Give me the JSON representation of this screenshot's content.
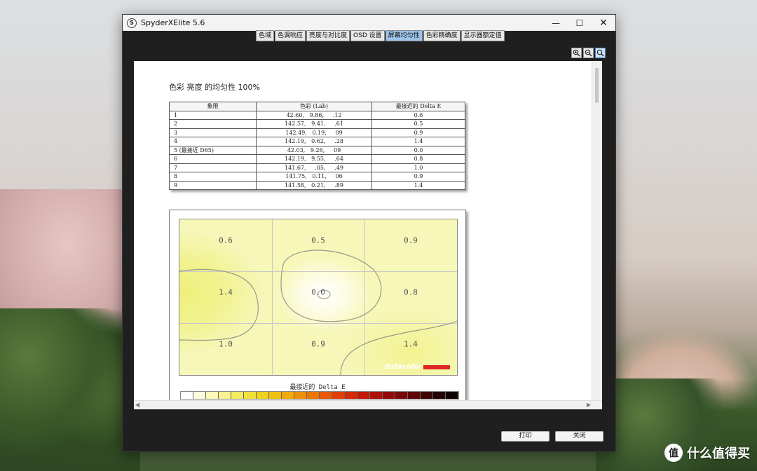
{
  "window": {
    "title": "SpyderXElite 5.6",
    "icon_letter": "S",
    "controls": {
      "minimize": "—",
      "maximize": "☐",
      "close": "✕"
    }
  },
  "tabs": [
    {
      "label": "色域",
      "active": false
    },
    {
      "label": "色调响应",
      "active": false
    },
    {
      "label": "亮度与对比度",
      "active": false
    },
    {
      "label": "OSD 设置",
      "active": false
    },
    {
      "label": "屏幕均匀性",
      "active": true
    },
    {
      "label": "色彩精确度",
      "active": false
    },
    {
      "label": "显示器额定值",
      "active": false
    }
  ],
  "zoom_tools": [
    "zoom-in-icon",
    "zoom-out-icon",
    "zoom-fit-icon"
  ],
  "report": {
    "title": "色彩 亮度 的均匀性 100%",
    "table": {
      "headers": [
        "象限",
        "色彩 (Lab)",
        "最接近的 Delta E"
      ],
      "rows": [
        [
          "1",
          "42.60,   9.86,     .12",
          "0.6"
        ],
        [
          "2",
          "142.57,   9.41,     .61",
          "0.5"
        ],
        [
          "3",
          "142.49,   0.19,     09",
          "0.9"
        ],
        [
          "4",
          "142.19,   0.62,     .28",
          "1.4"
        ],
        [
          "5 (最接近 D65)",
          "42.03,   9.26,     09",
          "0.0"
        ],
        [
          "6",
          "142.19,   9.55,     .64",
          "0.8"
        ],
        [
          "7",
          "141.67,     .05,     .49",
          "1.0"
        ],
        [
          "8",
          "141.75,   0.11,     06",
          "0.9"
        ],
        [
          "9",
          "141.58,   0.21,     .89",
          "1.4"
        ]
      ]
    },
    "heatmap_values": [
      [
        "0.6",
        "0.5",
        "0.9"
      ],
      [
        "1.4",
        "0.0",
        "0.8"
      ],
      [
        "1.0",
        "0.9",
        "1.4"
      ]
    ],
    "brand": "datacolor",
    "legend_title": "最接近的 Delta E"
  },
  "buttons": {
    "print": "打印",
    "close": "关闭"
  },
  "watermark": {
    "logo": "值",
    "text": "什么值得买"
  },
  "colors": {
    "active_tab": "#9ec4ec",
    "brand_red": "#e02424"
  }
}
